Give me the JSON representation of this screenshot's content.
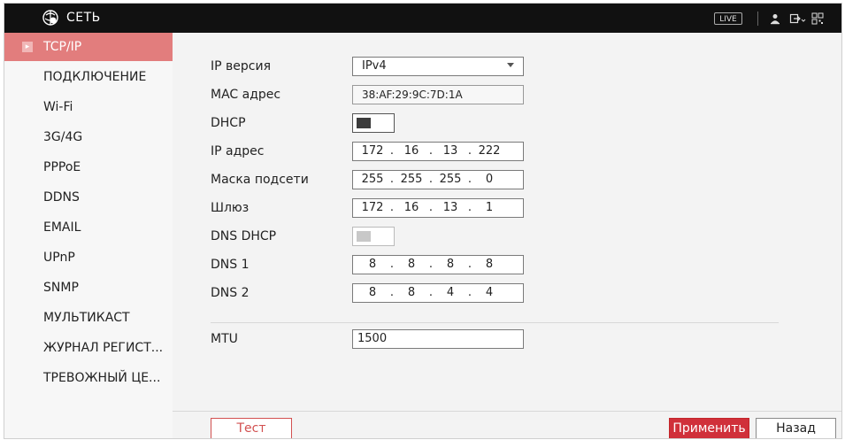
{
  "header": {
    "title": "СЕТЬ",
    "live_label": "LIVE"
  },
  "sidebar": {
    "items": [
      {
        "label": "TCP/IP"
      },
      {
        "label": "ПОДКЛЮЧЕНИЕ"
      },
      {
        "label": "Wi-Fi"
      },
      {
        "label": "3G/4G"
      },
      {
        "label": "PPPoE"
      },
      {
        "label": "DDNS"
      },
      {
        "label": "EMAIL"
      },
      {
        "label": "UPnP"
      },
      {
        "label": "SNMP"
      },
      {
        "label": "МУЛЬТИКАСТ"
      },
      {
        "label": "ЖУРНАЛ РЕГИСТ..."
      },
      {
        "label": "ТРЕВОЖНЫЙ ЦЕ..."
      }
    ],
    "active_index": 0
  },
  "form": {
    "ip_version": {
      "label": "IP версия",
      "value": "IPv4"
    },
    "mac": {
      "label": "MAC адрес",
      "value": "38:AF:29:9C:7D:1A"
    },
    "dhcp": {
      "label": "DHCP",
      "enabled": false
    },
    "ip_address": {
      "label": "IP адрес",
      "octets": [
        "172",
        "16",
        "13",
        "222"
      ]
    },
    "subnet_mask": {
      "label": "Маска подсети",
      "octets": [
        "255",
        "255",
        "255",
        "0"
      ]
    },
    "gateway": {
      "label": "Шлюз",
      "octets": [
        "172",
        "16",
        "13",
        "1"
      ]
    },
    "dns_dhcp": {
      "label": "DNS DHCP",
      "enabled": false,
      "disabled": true
    },
    "dns1": {
      "label": "DNS 1",
      "octets": [
        "8",
        "8",
        "8",
        "8"
      ]
    },
    "dns2": {
      "label": "DNS 2",
      "octets": [
        "8",
        "8",
        "4",
        "4"
      ]
    },
    "mtu": {
      "label": "MTU",
      "value": "1500"
    },
    "octet_separator": "."
  },
  "footer": {
    "test_label": "Тест",
    "apply_label": "Применить",
    "back_label": "Назад"
  },
  "colors": {
    "accent": "#d0303a",
    "active_menu": "#e27d7d",
    "topbar": "#111111"
  }
}
